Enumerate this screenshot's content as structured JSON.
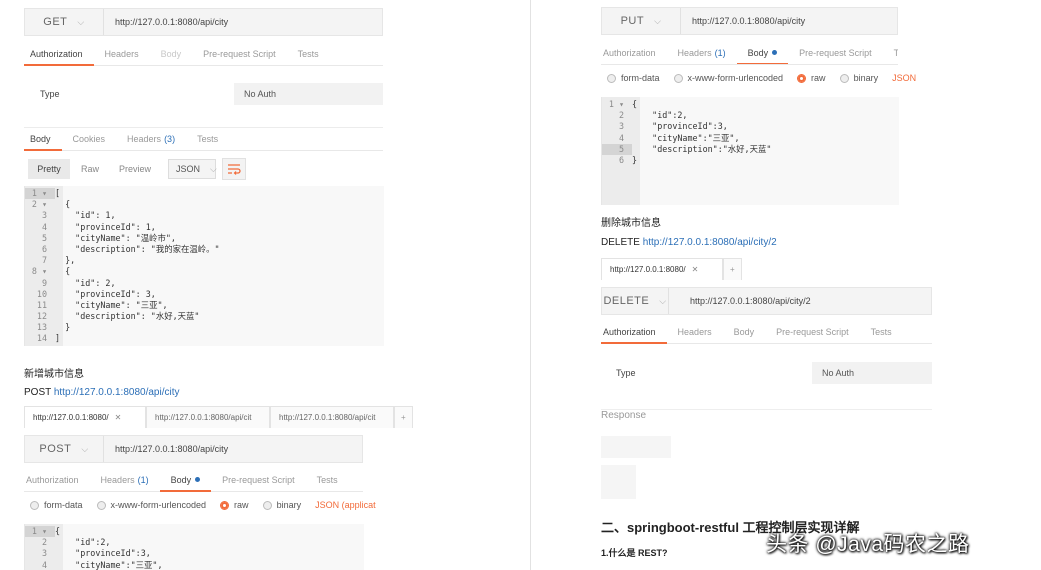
{
  "left": {
    "get_request": {
      "method": "GET",
      "url": "http://127.0.0.1:8080/api/city",
      "tabs": [
        "Authorization",
        "Headers",
        "Body",
        "Pre-request Script",
        "Tests"
      ],
      "type_label": "Type",
      "auth_value": "No Auth",
      "response_tabs": {
        "body": "Body",
        "cookies": "Cookies",
        "headers": "Headers",
        "headers_count": "(3)",
        "tests": "Tests"
      },
      "view_modes": [
        "Pretty",
        "Raw",
        "Preview"
      ],
      "format": "JSON",
      "code": [
        {
          "n": "1 ▾",
          "t": "["
        },
        {
          "n": "2 ▾",
          "t": "  {"
        },
        {
          "n": "3",
          "t": "    \"id\": 1,"
        },
        {
          "n": "4",
          "t": "    \"provinceId\": 1,"
        },
        {
          "n": "5",
          "t": "    \"cityName\": \"温岭市\","
        },
        {
          "n": "6",
          "t": "    \"description\": \"我的家在温岭。\""
        },
        {
          "n": "7",
          "t": "  },"
        },
        {
          "n": "8 ▾",
          "t": "  {"
        },
        {
          "n": "9",
          "t": "    \"id\": 2,"
        },
        {
          "n": "10",
          "t": "    \"provinceId\": 3,"
        },
        {
          "n": "11",
          "t": "    \"cityName\": \"三亚\","
        },
        {
          "n": "12",
          "t": "    \"description\": \"水好,天蓝\""
        },
        {
          "n": "13",
          "t": "  }"
        },
        {
          "n": "14",
          "t": "]"
        }
      ]
    },
    "post_section": {
      "heading": "新增城市信息",
      "prefix": "POST ",
      "link": "http://127.0.0.1:8080/api/city",
      "req_tabs": [
        "http://127.0.0.1:8080/",
        "http://127.0.0.1:8080/api/cit",
        "http://127.0.0.1:8080/api/cit"
      ],
      "close": "✕",
      "plus": "+",
      "method": "POST",
      "url": "http://127.0.0.1:8080/api/city",
      "tabs": {
        "auth": "Authorization",
        "headers": "Headers",
        "headers_count": "(1)",
        "body": "Body",
        "pre": "Pre-request Script",
        "tests": "Tests"
      },
      "body_types": [
        "form-data",
        "x-www-form-urlencoded",
        "raw",
        "binary"
      ],
      "json_label": "JSON (applicat",
      "code": [
        {
          "n": "1 ▾",
          "t": "{"
        },
        {
          "n": "2",
          "t": "    \"id\":2,"
        },
        {
          "n": "3",
          "t": "    \"provinceId\":3,"
        },
        {
          "n": "4",
          "t": "    \"cityName\":\"三亚\","
        }
      ]
    }
  },
  "right": {
    "put_request": {
      "method": "PUT",
      "url": "http://127.0.0.1:8080/api/city",
      "tabs": {
        "auth": "Authorization",
        "headers": "Headers",
        "headers_count": "(1)",
        "body": "Body",
        "pre": "Pre-request Script",
        "tests": "Te"
      },
      "body_types": [
        "form-data",
        "x-www-form-urlencoded",
        "raw",
        "binary"
      ],
      "json_label": "JSON",
      "code": [
        {
          "n": "1 ▾",
          "t": "{"
        },
        {
          "n": "2",
          "t": "    \"id\":2,"
        },
        {
          "n": "3",
          "t": "    \"provinceId\":3,"
        },
        {
          "n": "4",
          "t": "    \"cityName\":\"三亚\","
        },
        {
          "n": "5",
          "t": "    \"description\":\"水好,天蓝\""
        },
        {
          "n": "6",
          "t": "}"
        }
      ]
    },
    "delete_section": {
      "heading": "删除城市信息",
      "prefix": "DELETE ",
      "link": "http://127.0.0.1:8080/api/city/2",
      "req_tab": "http://127.0.0.1:8080/",
      "close": "✕",
      "plus": "+",
      "method": "DELETE",
      "url": "http://127.0.0.1:8080/api/city/2",
      "tabs": [
        "Authorization",
        "Headers",
        "Body",
        "Pre-request Script",
        "Tests"
      ],
      "type_label": "Type",
      "auth_value": "No Auth",
      "response_label": "Response"
    },
    "section_two": {
      "heading": "二、springboot-restful 工程控制层实现详解",
      "subheading": "1.什么是 REST?"
    },
    "watermark": "头条 @Java码农之路"
  }
}
